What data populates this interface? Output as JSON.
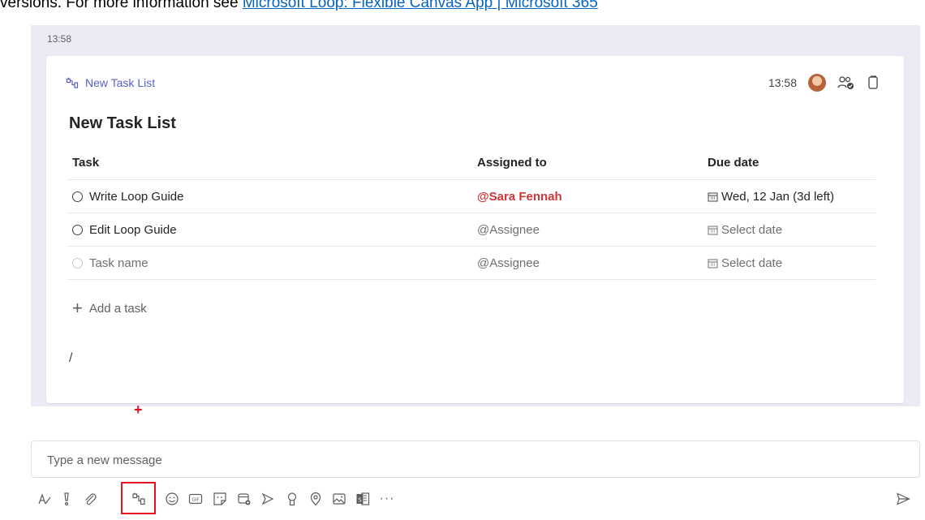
{
  "top_text": {
    "prefix": "versions.  For more information see ",
    "link": "Microsoft Loop: Flexible Canvas App | Microsoft 365"
  },
  "chat": {
    "timestamp": "13:58",
    "card": {
      "loop_link_label": "New Task List",
      "header_time": "13:58",
      "title": "New Task List",
      "columns": [
        "Task",
        "Assigned to",
        "Due date"
      ],
      "rows": [
        {
          "task": "Write Loop Guide",
          "assignee": "@Sara Fennah",
          "due": "Wed, 12 Jan (3d left)"
        },
        {
          "task": "Edit Loop Guide",
          "assignee": "@Assignee",
          "due": "Select date"
        },
        {
          "task": "Task name",
          "assignee": "@Assignee",
          "due": "Select date"
        }
      ],
      "add_task_label": "Add a task",
      "draft_text": "/"
    }
  },
  "annotation_plus": "+",
  "composer": {
    "placeholder": "Type a new message",
    "toolbar_icons": [
      "format-icon",
      "priority-icon",
      "attach-icon",
      "loop-component-icon",
      "emoji-icon",
      "gif-icon",
      "sticker-icon",
      "meet-now-icon",
      "stream-icon",
      "praise-icon",
      "location-icon",
      "image-icon",
      "app-icon",
      "more-options-icon",
      "send-icon"
    ],
    "more_label": "···"
  },
  "colors": {
    "accent": "#5b5fc7",
    "assignee": "#d13438",
    "highlight": "#e81123",
    "chat_background": "#ebebf5"
  }
}
